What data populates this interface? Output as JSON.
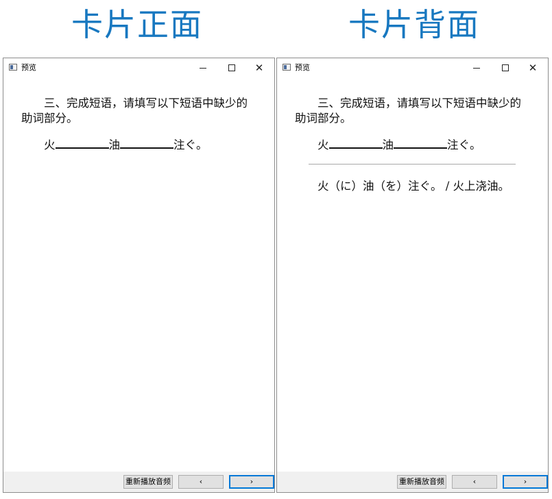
{
  "headings": {
    "front": "卡片正面",
    "back": "卡片背面"
  },
  "window": {
    "title": "预览"
  },
  "card": {
    "question": "三、完成短语，请填写以下短语中缺少的助词部分。",
    "fill_parts": [
      "火",
      "油",
      "注ぐ。"
    ],
    "answer": "火（に）油（を）注ぐ。 / 火上浇油。"
  },
  "buttons": {
    "replay": "重新播放音频",
    "prev": "‹",
    "next": "›"
  }
}
